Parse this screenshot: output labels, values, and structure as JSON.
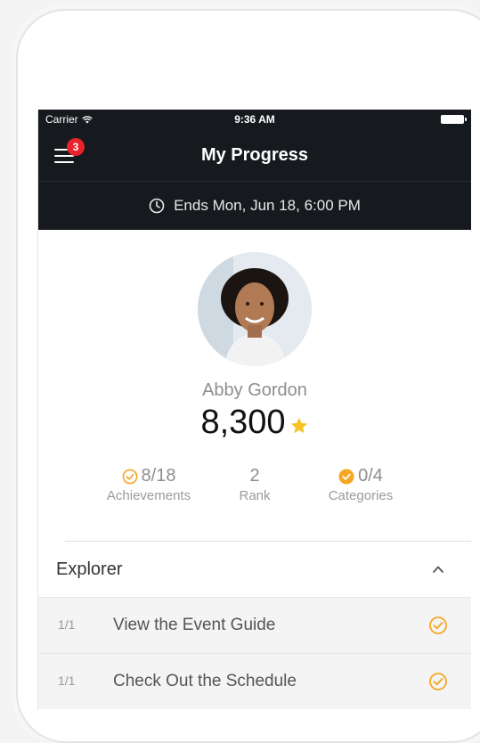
{
  "status_bar": {
    "carrier": "Carrier",
    "time": "9:36 AM"
  },
  "nav": {
    "title": "My Progress",
    "menu_badge": "3"
  },
  "ends": {
    "text": "Ends Mon, Jun 18, 6:00 PM"
  },
  "profile": {
    "name": "Abby Gordon",
    "points": "8,300"
  },
  "stats": [
    {
      "value": "8/18",
      "label": "Achievements",
      "icon": "check-circle-outline-icon"
    },
    {
      "value": "2",
      "label": "Rank"
    },
    {
      "value": "0/4",
      "label": "Categories",
      "icon": "check-circle-filled-icon"
    }
  ],
  "section": {
    "title": "Explorer",
    "expanded": true
  },
  "tasks": [
    {
      "count": "1/1",
      "title": "View the Event Guide",
      "done": true
    },
    {
      "count": "1/1",
      "title": "Check Out the Schedule",
      "done": true
    }
  ],
  "colors": {
    "nav_bg": "#16191d",
    "badge_red": "#e8232b",
    "accent_orange": "#f5a623",
    "star_yellow": "#f7c325"
  }
}
